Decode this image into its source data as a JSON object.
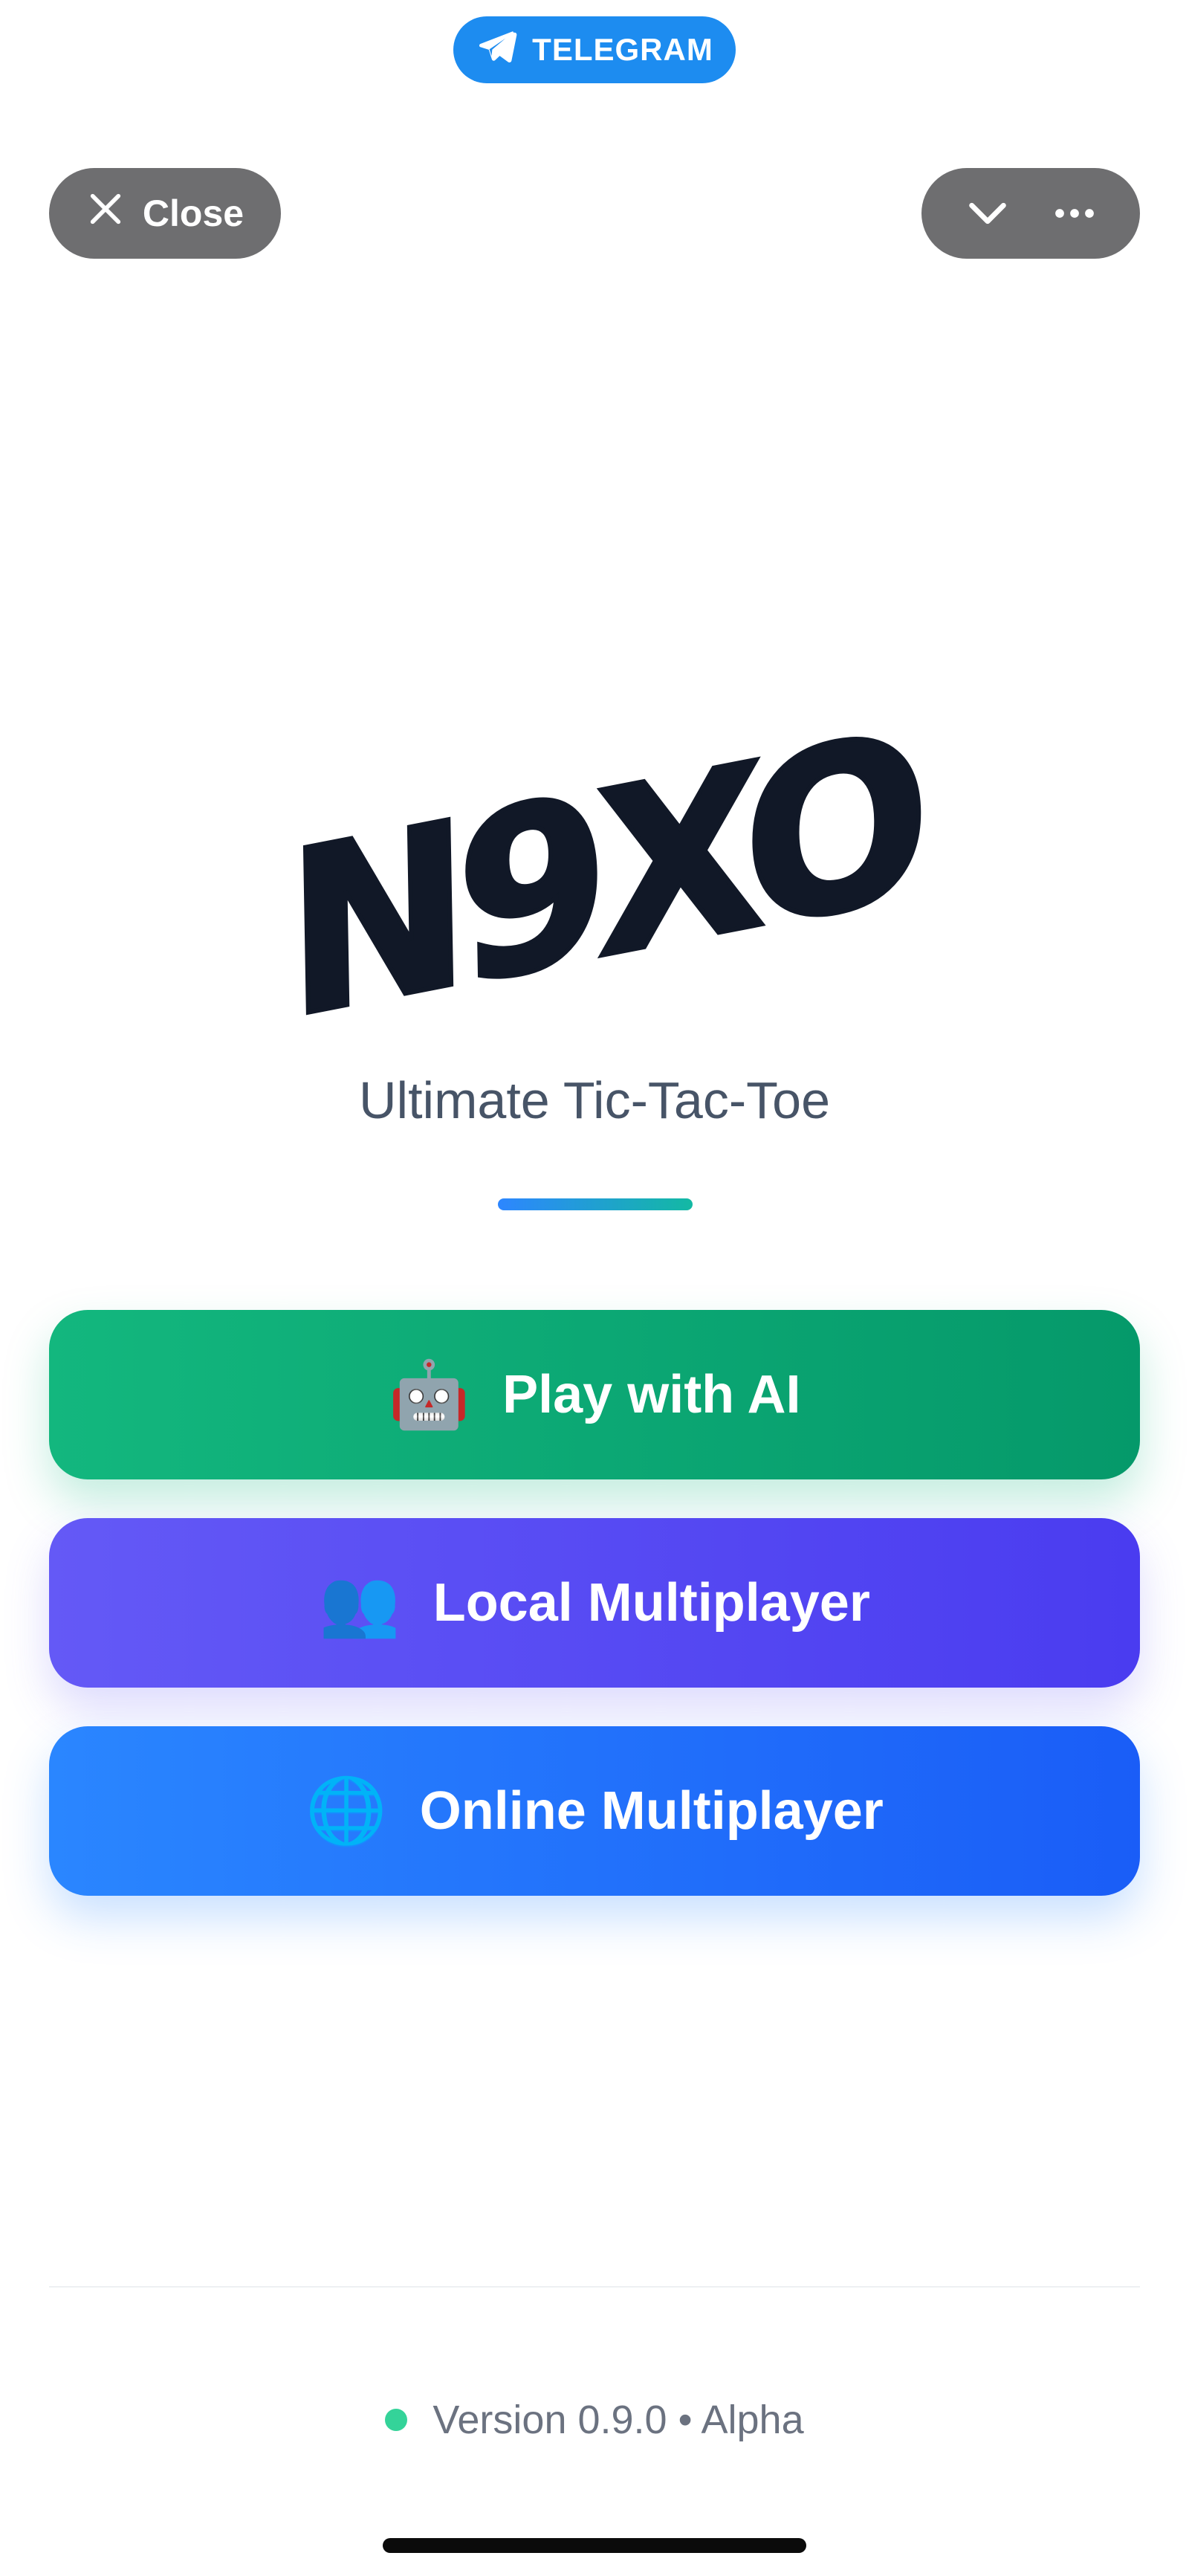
{
  "header": {
    "badge_label": "TELEGRAM",
    "close_label": "Close"
  },
  "app": {
    "logo_text": "N9XO",
    "subtitle": "Ultimate Tic-Tac-Toe"
  },
  "modes": [
    {
      "label": "Play with AI",
      "icon": "🤖",
      "icon_name": "robot-icon",
      "color_start": "#13b77e",
      "color_end": "#05996a"
    },
    {
      "label": "Local Multiplayer",
      "icon": "👥",
      "icon_name": "users-icon",
      "color_start": "#6459f6",
      "color_end": "#4a3cf0"
    },
    {
      "label": "Online Multiplayer",
      "icon": "🌐",
      "icon_name": "globe-icon",
      "color_start": "#2a86ff",
      "color_end": "#1a5df7"
    }
  ],
  "footer": {
    "version_text": "Version 0.9.0 • Alpha",
    "status_color": "#34d399"
  },
  "colors": {
    "telegram_blue": "#1d8cf0",
    "pill_gray": "#6e6e70",
    "logo": "#111827"
  }
}
